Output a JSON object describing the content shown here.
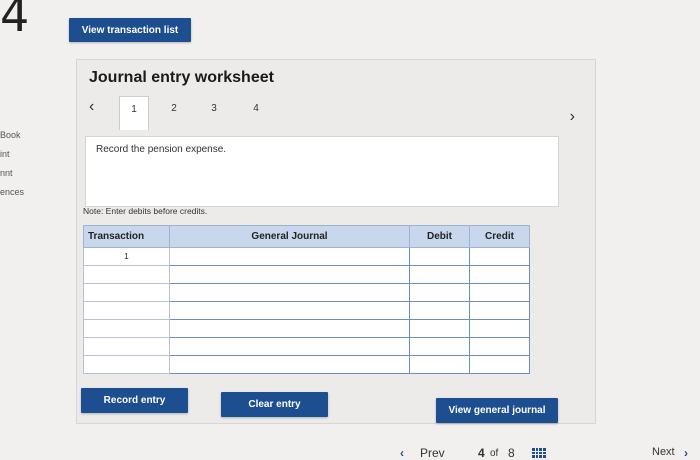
{
  "page_number": "4",
  "left_nav": [
    "Book",
    "int",
    "nnt",
    "ences"
  ],
  "buttons": {
    "view_transaction_list": "View transaction list",
    "record_entry": "Record entry",
    "clear_entry": "Clear entry",
    "view_general_journal": "View general journal"
  },
  "worksheet": {
    "title": "Journal entry worksheet",
    "tabs": [
      "1",
      "2",
      "3",
      "4"
    ],
    "active_tab": "1",
    "instruction": "Record the pension expense.",
    "note": "Note: Enter debits before credits."
  },
  "table": {
    "headers": [
      "Transaction",
      "General Journal",
      "Debit",
      "Credit"
    ],
    "rows": [
      {
        "transaction": "1",
        "general_journal": "",
        "debit": "",
        "credit": ""
      },
      {
        "transaction": "",
        "general_journal": "",
        "debit": "",
        "credit": ""
      },
      {
        "transaction": "",
        "general_journal": "",
        "debit": "",
        "credit": ""
      },
      {
        "transaction": "",
        "general_journal": "",
        "debit": "",
        "credit": ""
      },
      {
        "transaction": "",
        "general_journal": "",
        "debit": "",
        "credit": ""
      },
      {
        "transaction": "",
        "general_journal": "",
        "debit": "",
        "credit": ""
      },
      {
        "transaction": "",
        "general_journal": "",
        "debit": "",
        "credit": ""
      }
    ]
  },
  "footer": {
    "prev_label": "Prev",
    "page_current": "4",
    "page_of": "of",
    "page_total": "8",
    "next_label": "Next"
  },
  "colors": {
    "button_blue": "#1d4e8f",
    "header_blue": "#c9d7ec",
    "input_border": "#6a8fc2"
  }
}
